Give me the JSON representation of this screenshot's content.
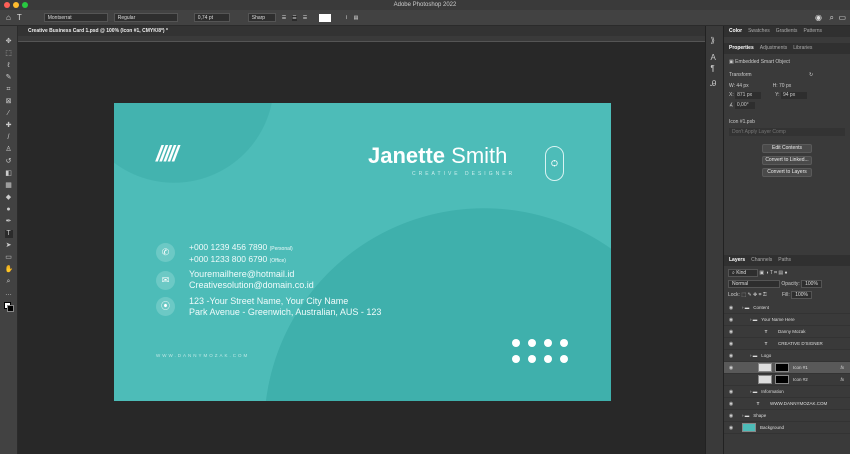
{
  "app": {
    "title": "Adobe Photoshop 2022"
  },
  "options": {
    "font_family": "Montserrat",
    "font_style": "Regular",
    "font_size": "0,74 pt",
    "antialias": "Sharp"
  },
  "document_tab": "Creative Business Card 1.psd @ 100% (Icon #1, CMYK/8*) *",
  "card": {
    "name_first": "Janette",
    "name_last": "Smith",
    "title": "CREATIVE DESIGNER",
    "phone1": "+000 1239 456 7890",
    "phone1_label": "(Personal)",
    "phone2": "+000 1233 800 6790",
    "phone2_label": "(Office)",
    "email1": "Youremailhere@hotmail.id",
    "email2": "Creativesolution@domain.co.id",
    "address1": "123 -Your Street Name, Your City Name",
    "address2": "Park Avenue - Greenwich, Australian, AUS - 123",
    "website": "WWW.DANNYMOZAK.COM",
    "slashes": "/////",
    "accent": "#4dbcb8"
  },
  "panels": {
    "top_tabs": [
      "Color",
      "Swatches",
      "Gradients",
      "Patterns"
    ],
    "prop_tabs": [
      "Properties",
      "Adjustments",
      "Libraries"
    ],
    "object_type": "Embedded Smart Object",
    "transform_label": "Transform",
    "w": "W: 44 px",
    "h": "H: 70 px",
    "x_label": "X:",
    "x": "871 px",
    "y_label": "Y:",
    "y": "94 px",
    "angle": "0,00°",
    "file": "Icon #1.psb",
    "layer_comp": "Don't Apply Layer Comp",
    "buttons": [
      "Edit Contents",
      "Convert to Linked...",
      "Convert to Layers"
    ],
    "layer_tabs": [
      "Layers",
      "Channels",
      "Paths"
    ],
    "kind": "Kind",
    "blend": "Normal",
    "opacity_label": "Opacity:",
    "opacity": "100%",
    "lock_label": "Lock:",
    "fill_label": "Fill:",
    "fill": "100%",
    "layers": [
      {
        "name": "Content",
        "indent": 0,
        "type": "folder"
      },
      {
        "name": "Your Name Here",
        "indent": 1,
        "type": "folder"
      },
      {
        "name": "Danny Mozak",
        "indent": 2,
        "type": "text"
      },
      {
        "name": "CREATIVE D'SIGNER",
        "indent": 2,
        "type": "text"
      },
      {
        "name": "Logo",
        "indent": 1,
        "type": "folder"
      },
      {
        "name": "Icon #1",
        "indent": 2,
        "type": "smart",
        "fx": "fx"
      },
      {
        "name": "Icon #2",
        "indent": 2,
        "type": "smart",
        "fx": "fx"
      },
      {
        "name": "Information",
        "indent": 1,
        "type": "folder"
      },
      {
        "name": "WWW.DANNYMOZAK.COM",
        "indent": 1,
        "type": "text"
      },
      {
        "name": "Shape",
        "indent": 0,
        "type": "folder"
      },
      {
        "name": "Background",
        "indent": 0,
        "type": "bg"
      }
    ]
  }
}
